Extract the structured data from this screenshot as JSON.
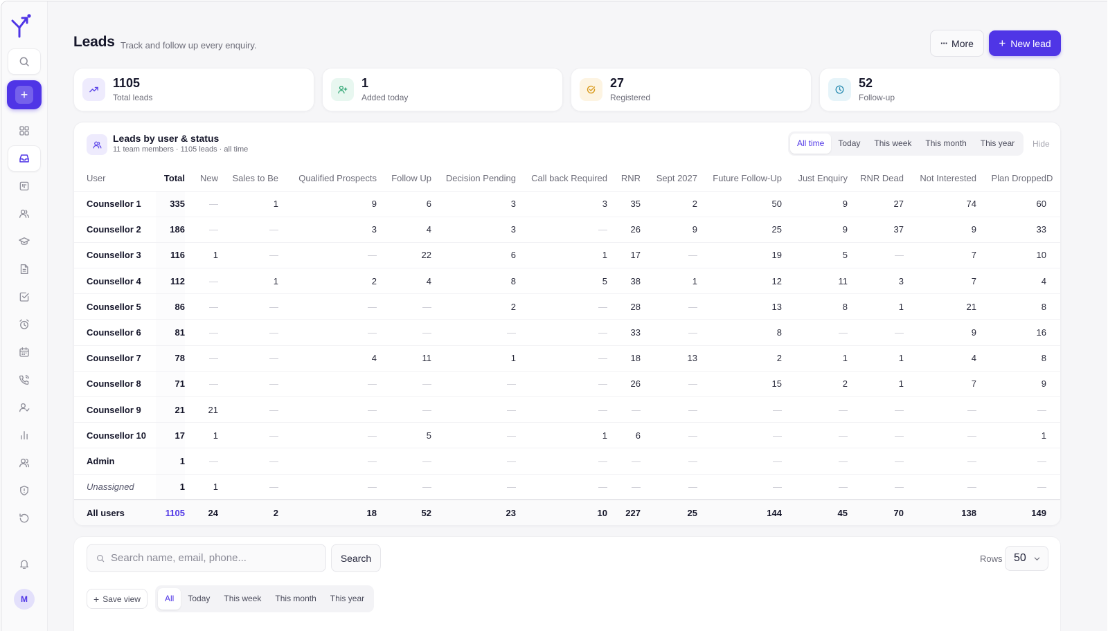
{
  "header": {
    "title": "Leads",
    "subtitle": "Track and follow up every enquiry.",
    "more_label": "More",
    "new_lead_label": "New lead"
  },
  "sidebar": {
    "avatar_initial": "M",
    "icons": [
      "search-icon",
      "add-icon",
      "dashboard-icon",
      "inbox-icon",
      "kanban-icon",
      "users-icon",
      "graduation-cap-icon",
      "document-icon",
      "checkbox-icon",
      "alarm-icon",
      "calendar-icon",
      "phone-icon",
      "user-check-icon",
      "bar-chart-icon",
      "team-icon",
      "shield-icon",
      "history-icon",
      "bell-icon"
    ],
    "active": "inbox-icon"
  },
  "stats": [
    {
      "value": "1105",
      "label": "Total leads",
      "icon": "trending-up-icon",
      "color": "#5b45e8",
      "bg": "#eeebfd"
    },
    {
      "value": "1",
      "label": "Added today",
      "icon": "user-plus-icon",
      "color": "#22a06b",
      "bg": "#e8f7f0"
    },
    {
      "value": "27",
      "label": "Registered",
      "icon": "check-circle-icon",
      "color": "#d99a1c",
      "bg": "#fdf4e2"
    },
    {
      "value": "52",
      "label": "Follow-up",
      "icon": "clock-icon",
      "color": "#2f8fb3",
      "bg": "#e6f4f9"
    }
  ],
  "leads_table": {
    "title": "Leads by user & status",
    "subtitle": "11 team members · 1105 leads · all time",
    "filters": [
      "All time",
      "Today",
      "This week",
      "This month",
      "This year"
    ],
    "active_filter": "All time",
    "hide_label": "Hide",
    "columns": [
      "User",
      "Total",
      "New",
      "Sales to Be",
      "Qualified Prospects",
      "Follow Up",
      "Decision Pending",
      "Call back Required",
      "RNR",
      "Sept 2027",
      "Future Follow-Up",
      "Just Enquiry",
      "RNR Dead",
      "Not Interested",
      "Plan Dropped",
      "D"
    ],
    "rows": [
      [
        "Counsellor 1",
        "335",
        "—",
        "1",
        "9",
        "6",
        "3",
        "3",
        "35",
        "2",
        "50",
        "9",
        "27",
        "74",
        "60",
        ""
      ],
      [
        "Counsellor 2",
        "186",
        "—",
        "—",
        "3",
        "4",
        "3",
        "—",
        "26",
        "9",
        "25",
        "9",
        "37",
        "9",
        "33",
        ""
      ],
      [
        "Counsellor 3",
        "116",
        "1",
        "—",
        "—",
        "22",
        "6",
        "1",
        "17",
        "—",
        "19",
        "5",
        "—",
        "7",
        "10",
        ""
      ],
      [
        "Counsellor 4",
        "112",
        "—",
        "1",
        "2",
        "4",
        "8",
        "5",
        "38",
        "1",
        "12",
        "11",
        "3",
        "7",
        "4",
        ""
      ],
      [
        "Counsellor 5",
        "86",
        "—",
        "—",
        "—",
        "—",
        "2",
        "—",
        "28",
        "—",
        "13",
        "8",
        "1",
        "21",
        "8",
        ""
      ],
      [
        "Counsellor 6",
        "81",
        "—",
        "—",
        "—",
        "—",
        "—",
        "—",
        "33",
        "—",
        "8",
        "—",
        "—",
        "9",
        "16",
        ""
      ],
      [
        "Counsellor 7",
        "78",
        "—",
        "—",
        "4",
        "11",
        "1",
        "—",
        "18",
        "13",
        "2",
        "1",
        "1",
        "4",
        "8",
        ""
      ],
      [
        "Counsellor 8",
        "71",
        "—",
        "—",
        "—",
        "—",
        "—",
        "—",
        "26",
        "—",
        "15",
        "2",
        "1",
        "7",
        "9",
        ""
      ],
      [
        "Counsellor 9",
        "21",
        "21",
        "—",
        "—",
        "—",
        "—",
        "—",
        "—",
        "—",
        "—",
        "—",
        "—",
        "—",
        "—",
        ""
      ],
      [
        "Counsellor 10",
        "17",
        "1",
        "—",
        "—",
        "5",
        "—",
        "1",
        "6",
        "—",
        "—",
        "—",
        "—",
        "—",
        "1",
        ""
      ],
      [
        "Admin",
        "1",
        "—",
        "—",
        "—",
        "—",
        "—",
        "—",
        "—",
        "—",
        "—",
        "—",
        "—",
        "—",
        "—",
        ""
      ],
      [
        "Unassigned",
        "1",
        "1",
        "—",
        "—",
        "—",
        "—",
        "—",
        "—",
        "—",
        "—",
        "—",
        "—",
        "—",
        "—",
        ""
      ]
    ],
    "footer": [
      "All users",
      "1105",
      "24",
      "2",
      "18",
      "52",
      "23",
      "10",
      "227",
      "25",
      "144",
      "45",
      "70",
      "138",
      "149",
      ""
    ]
  },
  "search": {
    "placeholder": "Search name, email, phone...",
    "button_label": "Search",
    "rows_label": "Rows",
    "rows_value": "50",
    "save_view_label": "Save view",
    "filters": [
      "All",
      "Today",
      "This week",
      "This month",
      "This year"
    ],
    "active_filter": "All"
  },
  "colors": {
    "accent": "#4f35e6",
    "background": "#f6f6f8"
  }
}
